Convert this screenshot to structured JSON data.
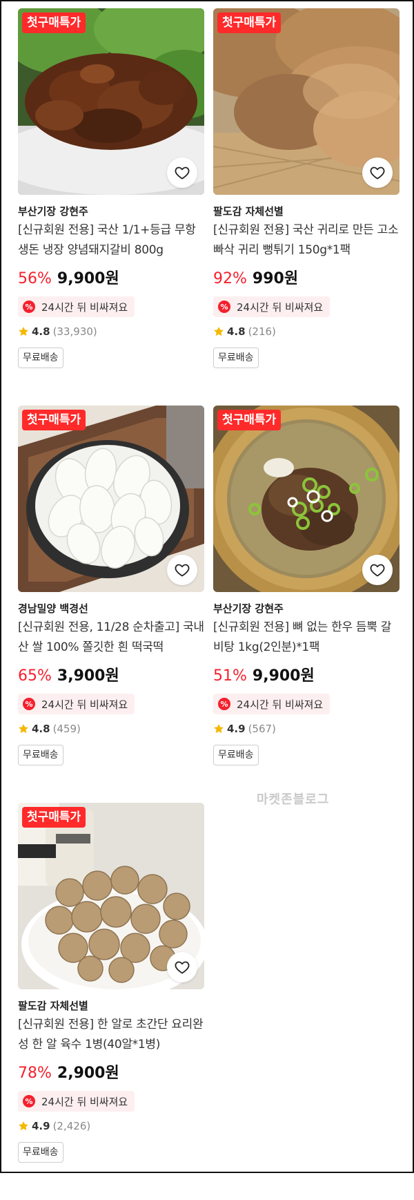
{
  "badge_label": "첫구매특가",
  "watermark": "마켓존블로그",
  "products": [
    {
      "seller": "부산기장 강현주",
      "title": "[신규회원 전용] 국산 1/1+등급 무항생돈 냉장 양념돼지갈비 800g",
      "discount": "56%",
      "price": "9,900원",
      "timer": "24시간 뒤 비싸져요",
      "rating": "4.8",
      "review_count": "(33,930)",
      "shipping": "무료배송"
    },
    {
      "seller": "팔도감 자체선별",
      "title": "[신규회원 전용] 국산 귀리로 만든 고소 빠삭 귀리 뻥튀기 150g*1팩",
      "discount": "92%",
      "price": "990원",
      "timer": "24시간 뒤 비싸져요",
      "rating": "4.8",
      "review_count": "(216)",
      "shipping": "무료배송"
    },
    {
      "seller": "경남밀양 백경선",
      "title": "[신규회원 전용, 11/28 순차출고] 국내산 쌀 100% 쫄깃한 흰 떡국떡",
      "discount": "65%",
      "price": "3,900원",
      "timer": "24시간 뒤 비싸져요",
      "rating": "4.8",
      "review_count": "(459)",
      "shipping": "무료배송"
    },
    {
      "seller": "부산기장 강현주",
      "title": "[신규회원 전용] 뼈 없는 한우 듬뿍 갈비탕 1kg(2인분)*1팩",
      "discount": "51%",
      "price": "9,900원",
      "timer": "24시간 뒤 비싸져요",
      "rating": "4.9",
      "review_count": "(567)",
      "shipping": "무료배송"
    },
    {
      "seller": "팔도감 자체선별",
      "title": "[신규회원 전용] 한 알로 초간단 요리완성 한 알 육수 1병(40알*1병)",
      "discount": "78%",
      "price": "2,900원",
      "timer": "24시간 뒤 비싸져요",
      "rating": "4.9",
      "review_count": "(2,426)",
      "shipping": "무료배송"
    }
  ],
  "colors": {
    "badge": "#ff2a2a",
    "discount": "#f5202d",
    "timer_bg": "#fdeff0",
    "star": "#f5b800"
  },
  "icons": {
    "heart": "heart-icon",
    "timer": "discount-clock-icon",
    "star": "star-icon"
  }
}
